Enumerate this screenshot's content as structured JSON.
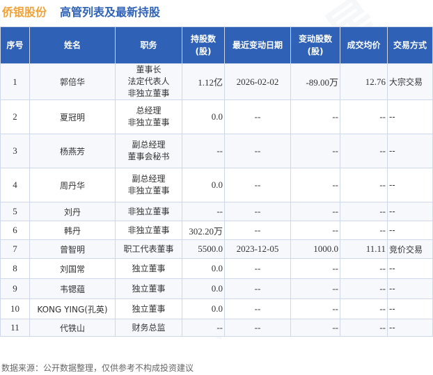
{
  "header": {
    "company": "侨银股份",
    "title": "高管列表及最新持股"
  },
  "columns": {
    "index": "序号",
    "name": "姓名",
    "role": "职务",
    "holding": "持股数(股)",
    "date": "最近变动日期",
    "change": "变动股数(股)",
    "price": "成交均价",
    "method": "交易方式"
  },
  "rows": [
    {
      "index": "1",
      "name": "郭倍华",
      "roles": [
        "董事长",
        "法定代表人",
        "非独立董事"
      ],
      "holding": "1.12亿",
      "date": "2026-02-02",
      "change": "-89.00万",
      "price": "12.76",
      "method": "大宗交易"
    },
    {
      "index": "2",
      "name": "夏冠明",
      "roles": [
        "总经理",
        "非独立董事"
      ],
      "holding": "0.0",
      "date": "--",
      "change": "--",
      "price": "--",
      "method": "--"
    },
    {
      "index": "3",
      "name": "杨燕芳",
      "roles": [
        "副总经理",
        "董事会秘书"
      ],
      "holding": "--",
      "date": "--",
      "change": "--",
      "price": "--",
      "method": "--"
    },
    {
      "index": "4",
      "name": "周丹华",
      "roles": [
        "副总经理",
        "非独立董事"
      ],
      "holding": "0.0",
      "date": "--",
      "change": "--",
      "price": "--",
      "method": "--"
    },
    {
      "index": "5",
      "name": "刘丹",
      "roles": [
        "非独立董事"
      ],
      "holding": "--",
      "date": "--",
      "change": "--",
      "price": "--",
      "method": "--"
    },
    {
      "index": "6",
      "name": "韩丹",
      "roles": [
        "非独立董事"
      ],
      "holding": "302.20万",
      "date": "--",
      "change": "--",
      "price": "--",
      "method": "--"
    },
    {
      "index": "7",
      "name": "曾智明",
      "roles": [
        "职工代表董事"
      ],
      "holding": "5500.0",
      "date": "2023-12-05",
      "change": "1000.0",
      "price": "11.11",
      "method": "竞价交易"
    },
    {
      "index": "8",
      "name": "刘国常",
      "roles": [
        "独立董事"
      ],
      "holding": "0.0",
      "date": "--",
      "change": "--",
      "price": "--",
      "method": "--"
    },
    {
      "index": "9",
      "name": "韦锶蕴",
      "roles": [
        "独立董事"
      ],
      "holding": "0.0",
      "date": "--",
      "change": "--",
      "price": "--",
      "method": "--"
    },
    {
      "index": "10",
      "name": "KONG YING(孔英)",
      "roles": [
        "独立董事"
      ],
      "holding": "0.0",
      "date": "--",
      "change": "--",
      "price": "--",
      "method": "--"
    },
    {
      "index": "11",
      "name": "代铁山",
      "roles": [
        "财务总监"
      ],
      "holding": "--",
      "date": "--",
      "change": "--",
      "price": "--",
      "method": "--"
    }
  ],
  "footer": "数据来源：公开数据整理，仅供参考不构成投资建议",
  "watermark": "证券之星",
  "colors": {
    "header_bg": "#2f62b6",
    "company": "#f0a23a",
    "negative": "#1ea11e",
    "positive": "#e0261d"
  }
}
